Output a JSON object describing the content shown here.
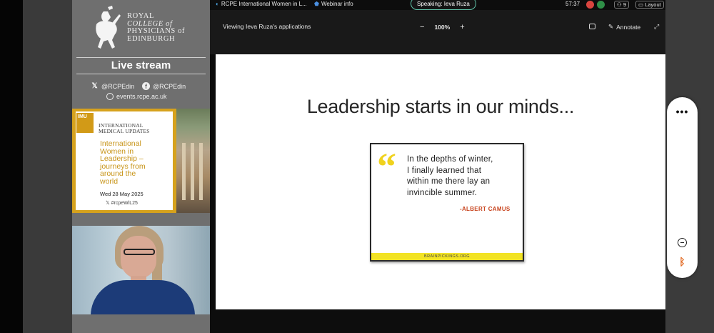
{
  "topbar": {
    "meeting_title": "RCPE International Women in L...",
    "webinar_info": "Webinar info",
    "speaking": "Speaking: Ieva Ruza",
    "timer": "57:37",
    "participants": "9",
    "layout_label": "Layout"
  },
  "sharebar": {
    "viewing": "Viewing Ieva Ruza's applications",
    "zoom_out": "−",
    "zoom_level": "100%",
    "zoom_in": "+",
    "annotate": "Annotate"
  },
  "side_panel": {
    "logo_lines": [
      "ROYAL",
      "COLLEGE of",
      "PHYSICIANS of",
      "EDINBURGH"
    ],
    "live_stream": "Live stream",
    "twitter": "@RCPEdin",
    "facebook": "@RCPEdin",
    "website": "events.rcpe.ac.uk",
    "promo": {
      "badge": "IMU",
      "header_line1": "INTERNATIONAL",
      "header_line2": "MEDICAL UPDATES",
      "title_lines": [
        "International",
        "Women in",
        "Leadership –",
        "journeys from",
        "around the",
        "world"
      ],
      "date": "Wed 28 May 2025",
      "hashtag": "#rcpeWiL25"
    }
  },
  "slide": {
    "title": "Leadership starts in our minds...",
    "quote_lines": [
      "In the depths of winter,",
      "I finally learned that",
      "within me there lay an",
      "invincible summer."
    ],
    "author": "-ALBERT CAMUS",
    "footer": "BRAINPICKINGS.ORG"
  },
  "colors": {
    "accent_speaking": "#5fc3a8",
    "promo_gold": "#d6a21d",
    "quote_yellow": "#f0d21e",
    "author_red": "#c8441e"
  },
  "icons": [
    "share-icon",
    "shield-icon",
    "leave-icon",
    "mic-icon",
    "people-icon",
    "layout-icon",
    "annotate-icon",
    "expand-icon",
    "more-icon",
    "minimize-icon",
    "bluetooth-icon"
  ]
}
